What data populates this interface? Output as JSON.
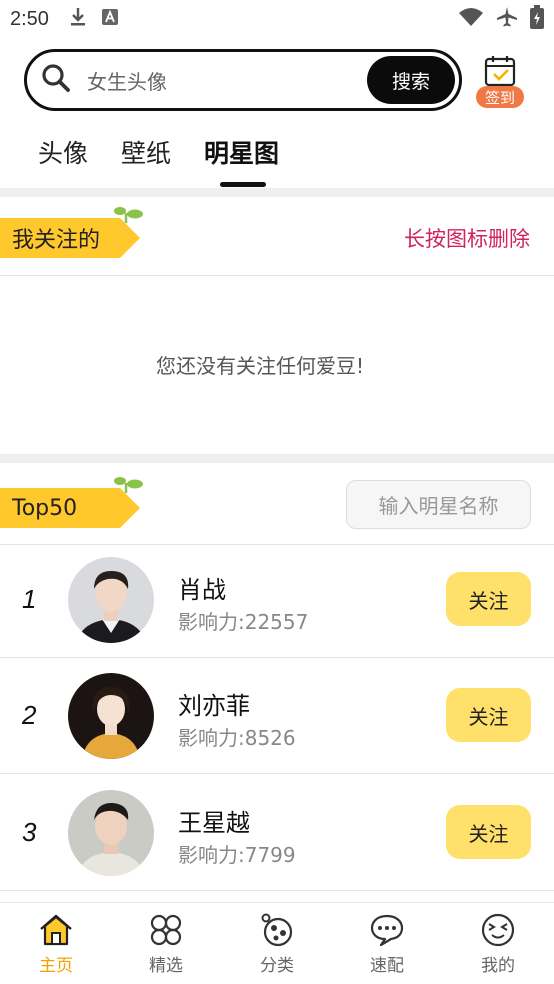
{
  "status_bar": {
    "time": "2:50"
  },
  "search": {
    "placeholder": "女生头像",
    "button_label": "搜索"
  },
  "checkin": {
    "label": "签到"
  },
  "tabs": [
    {
      "label": "头像"
    },
    {
      "label": "壁纸"
    },
    {
      "label": "明星图"
    }
  ],
  "active_tab": "明星图",
  "following": {
    "title": "我关注的",
    "hint": "长按图标删除",
    "empty_message": "您还没有关注任何爱豆!"
  },
  "top50": {
    "title": "Top50",
    "search_placeholder": "输入明星名称",
    "items": [
      {
        "rank": "1",
        "name": "肖战",
        "influence": "影响力:22557",
        "button": "关注"
      },
      {
        "rank": "2",
        "name": "刘亦菲",
        "influence": "影响力:8526",
        "button": "关注"
      },
      {
        "rank": "3",
        "name": "王星越",
        "influence": "影响力:7799",
        "button": "关注"
      }
    ]
  },
  "bottom_nav": [
    {
      "label": "主页",
      "icon": "home-icon"
    },
    {
      "label": "精选",
      "icon": "clover-icon"
    },
    {
      "label": "分类",
      "icon": "category-icon"
    },
    {
      "label": "速配",
      "icon": "chat-bubble-icon"
    },
    {
      "label": "我的",
      "icon": "face-icon"
    }
  ],
  "colors": {
    "accent": "#ffc82c",
    "button": "#ffe06b",
    "hint": "#d1235c",
    "nav_active": "#f2a100"
  }
}
